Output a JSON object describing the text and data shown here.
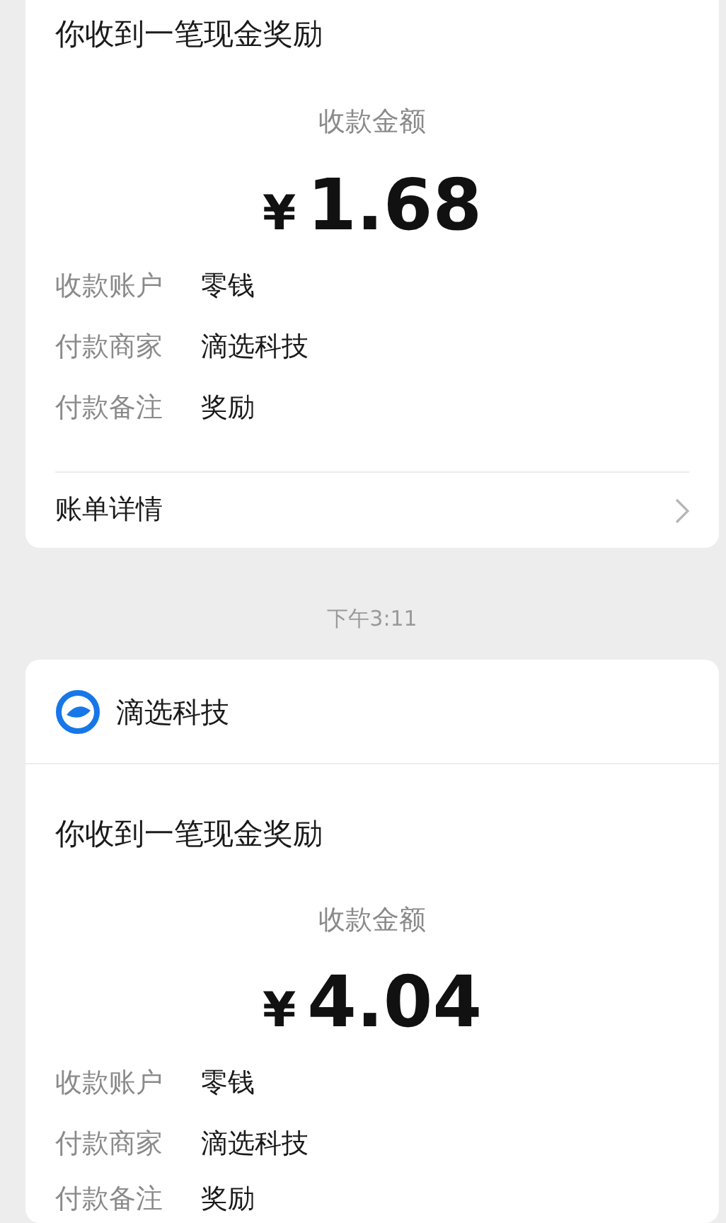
{
  "messages": [
    {
      "kind": "payment",
      "title": "你收到一笔现金奖励",
      "amount_label": "收款金额",
      "currency": "¥",
      "amount": "1.68",
      "details": [
        {
          "label": "收款账户",
          "value": "零钱"
        },
        {
          "label": "付款商家",
          "value": "滴选科技"
        },
        {
          "label": "付款备注",
          "value": "奖励"
        }
      ],
      "link": "账单详情"
    },
    {
      "kind": "timestamp",
      "text": "下午3:11"
    },
    {
      "kind": "payment",
      "merchant": "滴选科技",
      "title": "你收到一笔现金奖励",
      "amount_label": "收款金额",
      "currency": "¥",
      "amount": "4.04",
      "details": [
        {
          "label": "收款账户",
          "value": "零钱"
        },
        {
          "label": "付款商家",
          "value": "滴选科技"
        },
        {
          "label": "付款备注",
          "value": "奖励"
        }
      ]
    }
  ]
}
